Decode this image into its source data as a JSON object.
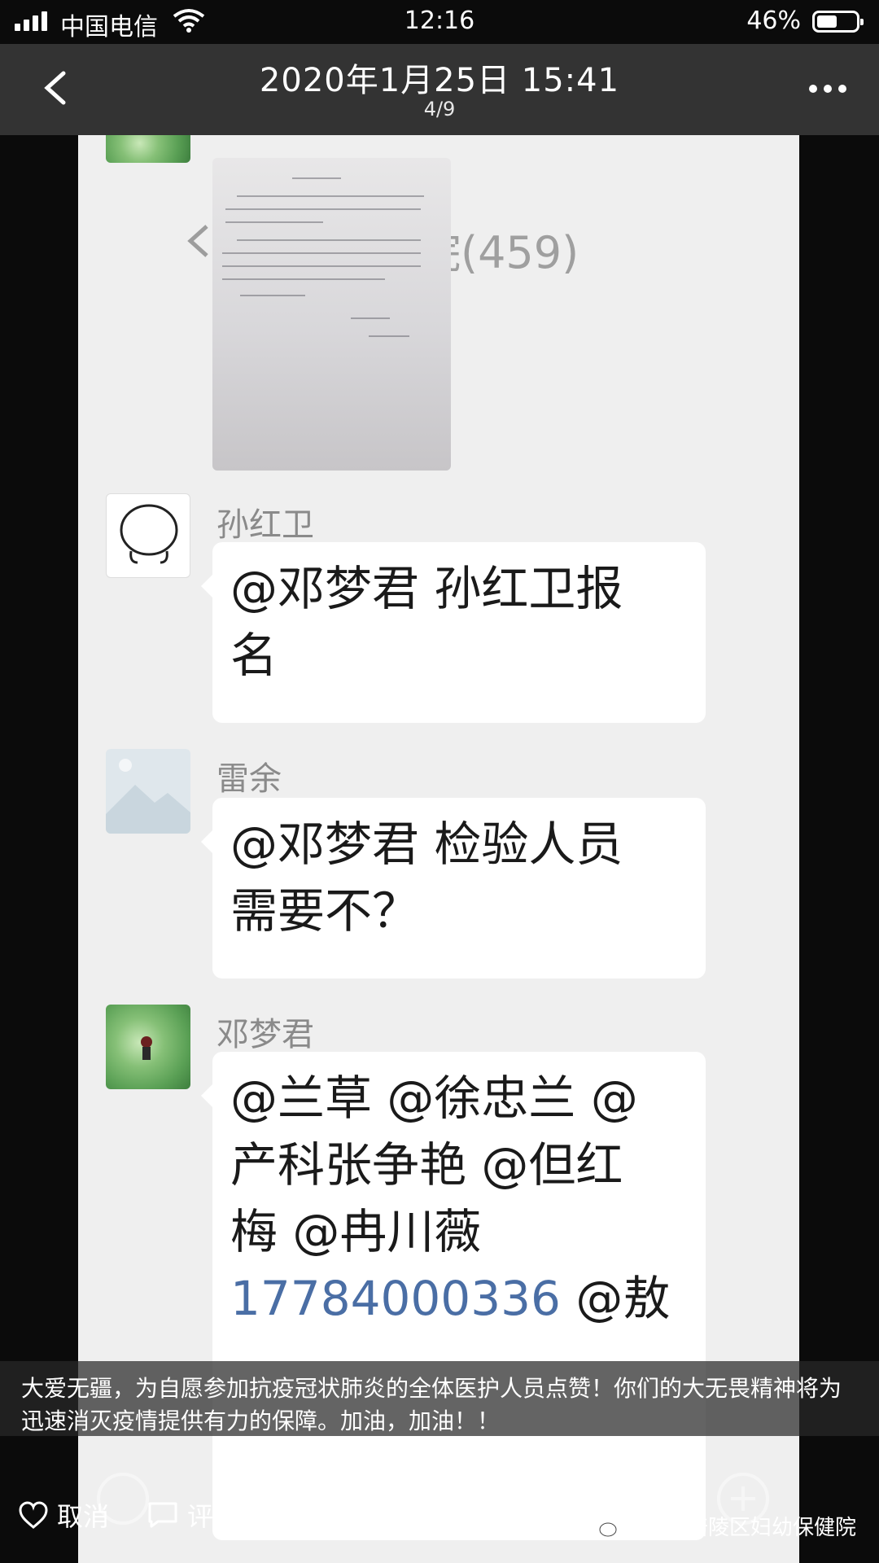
{
  "status_bar": {
    "carrier": "中国电信",
    "time": "12:16",
    "battery": "46%",
    "battery_level": 0.46
  },
  "header": {
    "date": "2020年1月25日 15:41",
    "index": "4/9"
  },
  "photo": {
    "background_title": "妇幼保健院(459)",
    "messages": [
      {
        "sender": "孙红卫",
        "lines": [
          "@邓梦君  孙红卫报",
          "名"
        ]
      },
      {
        "sender": "雷余",
        "lines": [
          "@邓梦君  检验人员",
          "需要不？"
        ]
      },
      {
        "sender": "邓梦君",
        "lines": [
          "@兰草 @徐忠兰 @",
          "产科张争艳 @但红",
          "梅 @冉川薇"
        ],
        "phone": "17784000336",
        "tail": " @敖"
      }
    ]
  },
  "caption": "大爱无疆，为自愿参加抗疫冠状肺炎的全体医护人员点赞！你们的大无畏精神将为迅速消灭疫情提供有力的保障。加油，加油！！",
  "actions": {
    "like_label": "取消",
    "comment_label": "评论"
  },
  "watermark": "重庆市涪陵区妇幼保健院",
  "colors": {
    "link": "#4a6ea5",
    "header_bg": "#373737"
  }
}
